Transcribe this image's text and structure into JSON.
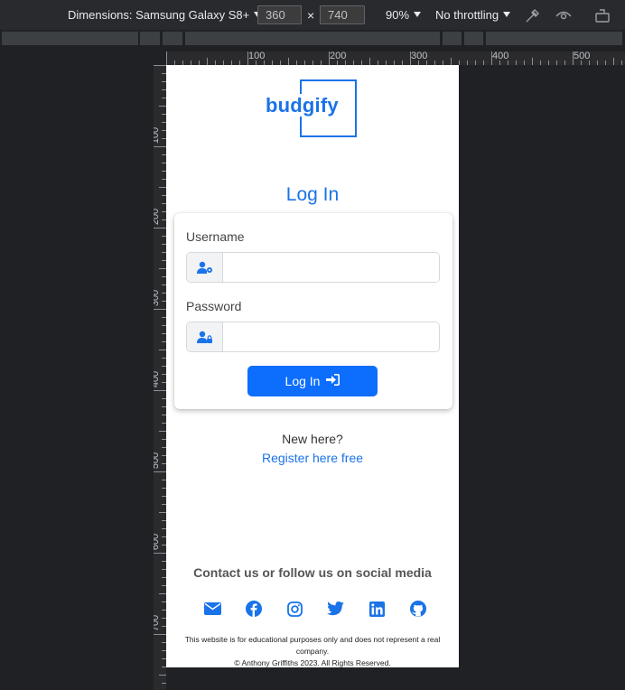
{
  "devtools": {
    "device_label": "Dimensions: Samsung Galaxy S8+",
    "width_value": "360",
    "times_sign": "×",
    "height_value": "740",
    "zoom": "90%",
    "throttling": "No throttling",
    "ruler_top_labels": [
      "100",
      "200",
      "300",
      "400",
      "500"
    ],
    "ruler_left_labels": [
      "100",
      "200",
      "300",
      "400",
      "500",
      "600",
      "700"
    ]
  },
  "app": {
    "logo_text": "budgify",
    "page_title": "Log In",
    "username_label": "Username",
    "password_label": "Password",
    "login_button": "Log In",
    "new_here": "New here?",
    "register_link": "Register here free",
    "contact_heading": "Contact us or follow us on social media",
    "social_icons": [
      "envelope-icon",
      "facebook-icon",
      "instagram-icon",
      "twitter-icon",
      "linkedin-icon",
      "github-icon"
    ],
    "disclaimer": "This website is for educational purposes only and does not represent a real company.",
    "copyright": "© Anthony Griffiths 2023. All Rights Reserved.",
    "brand_color": "#1a73e8",
    "button_color": "#0d6efd"
  }
}
